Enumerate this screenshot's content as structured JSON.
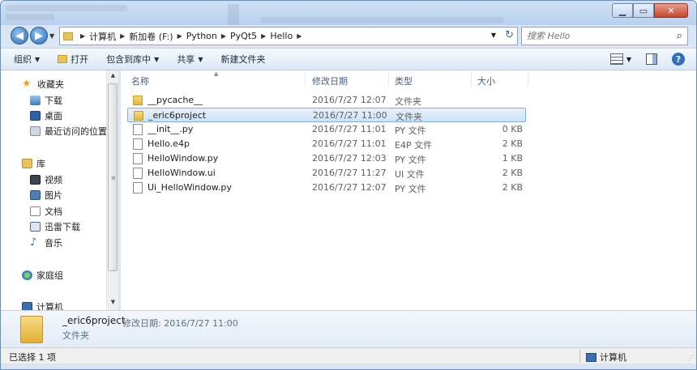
{
  "window": {
    "controls": {
      "minimize": "▁",
      "maximize": "▭",
      "close": "✕"
    }
  },
  "address_bar": {
    "breadcrumbs": [
      "计算机",
      "新加卷 (F:)",
      "Python",
      "PyQt5",
      "Hello"
    ],
    "search_placeholder": "搜索 Hello"
  },
  "toolbar": {
    "organize": "组织",
    "open": "打开",
    "include_in_library": "包含到库中",
    "share": "共享",
    "new_folder": "新建文件夹"
  },
  "sidebar": {
    "favorites": "收藏夹",
    "downloads": "下载",
    "desktop": "桌面",
    "recent": "最近访问的位置",
    "libraries": "库",
    "videos": "视频",
    "pictures": "图片",
    "documents": "文档",
    "xunlei": "迅雷下载",
    "music": "音乐",
    "homegroup": "家庭组",
    "computer": "计算机"
  },
  "columns": {
    "name": "名称",
    "modified": "修改日期",
    "type": "类型",
    "size": "大小"
  },
  "files": [
    {
      "name": "__pycache__",
      "modified": "2016/7/27 12:07",
      "type": "文件夹",
      "size": "",
      "icon": "folder-icon"
    },
    {
      "name": "_eric6project",
      "modified": "2016/7/27 11:00",
      "type": "文件夹",
      "size": "",
      "icon": "folder-icon"
    },
    {
      "name": "__init__.py",
      "modified": "2016/7/27 11:01",
      "type": "PY 文件",
      "size": "0 KB",
      "icon": "document-icon"
    },
    {
      "name": "Hello.e4p",
      "modified": "2016/7/27 11:01",
      "type": "E4P 文件",
      "size": "2 KB",
      "icon": "document-icon"
    },
    {
      "name": "HelloWindow.py",
      "modified": "2016/7/27 12:03",
      "type": "PY 文件",
      "size": "1 KB",
      "icon": "document-icon"
    },
    {
      "name": "HelloWindow.ui",
      "modified": "2016/7/27 11:27",
      "type": "UI 文件",
      "size": "2 KB",
      "icon": "document-icon"
    },
    {
      "name": "Ui_HelloWindow.py",
      "modified": "2016/7/27 12:07",
      "type": "PY 文件",
      "size": "2 KB",
      "icon": "document-icon"
    }
  ],
  "details": {
    "name": "_eric6project",
    "modified_label": "修改日期: 2016/7/27 11:00",
    "type": "文件夹"
  },
  "status": {
    "selected": "已选择 1 项",
    "location": "计算机"
  }
}
